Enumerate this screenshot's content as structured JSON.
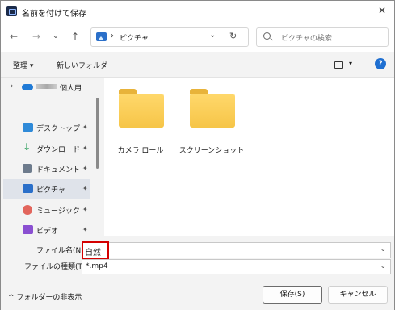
{
  "window": {
    "title": "名前を付けて保存",
    "close_glyph": "✕"
  },
  "nav": {
    "back_glyph": "←",
    "forward_glyph": "→",
    "recent_glyph": "⌄",
    "up_glyph": "↑",
    "address_sep": "›",
    "address_text": "ピクチャ",
    "address_chevron": "⌄",
    "refresh_glyph": "↻",
    "search_placeholder": "ピクチャの検索"
  },
  "toolbar": {
    "organize_label": "整理 ▾",
    "new_folder_label": "新しいフォルダー",
    "view_caret": "▾",
    "help_glyph": "?"
  },
  "sidebar": {
    "cloud_expander": "›",
    "cloud_label": "個人用",
    "pin_glyph": "📌",
    "items": [
      {
        "label": "デスクトップ",
        "icon": "desktop-icon",
        "color": "#2f8ad8"
      },
      {
        "label": "ダウンロード",
        "icon": "download-icon",
        "color": "#2a9d59"
      },
      {
        "label": "ドキュメント",
        "icon": "document-icon",
        "color": "#6d7b8c"
      },
      {
        "label": "ピクチャ",
        "icon": "pictures-icon",
        "color": "#2a6fc9"
      },
      {
        "label": "ミュージック",
        "icon": "music-icon",
        "color": "#e2655c"
      },
      {
        "label": "ビデオ",
        "icon": "video-icon",
        "color": "#8a4fd1"
      }
    ]
  },
  "content": {
    "folders": [
      {
        "label": "カメラ ロール"
      },
      {
        "label": "スクリーンショット"
      }
    ]
  },
  "form": {
    "filename_label": "ファイル名(N):",
    "filename_value": "自然",
    "filetype_label": "ファイルの種類(T):",
    "filetype_value": "*.mp4",
    "hide_folders_label": "^  フォルダーの非表示",
    "save_label": "保存(S)",
    "cancel_label": "キャンセル",
    "dropdown_chevron": "⌄"
  }
}
